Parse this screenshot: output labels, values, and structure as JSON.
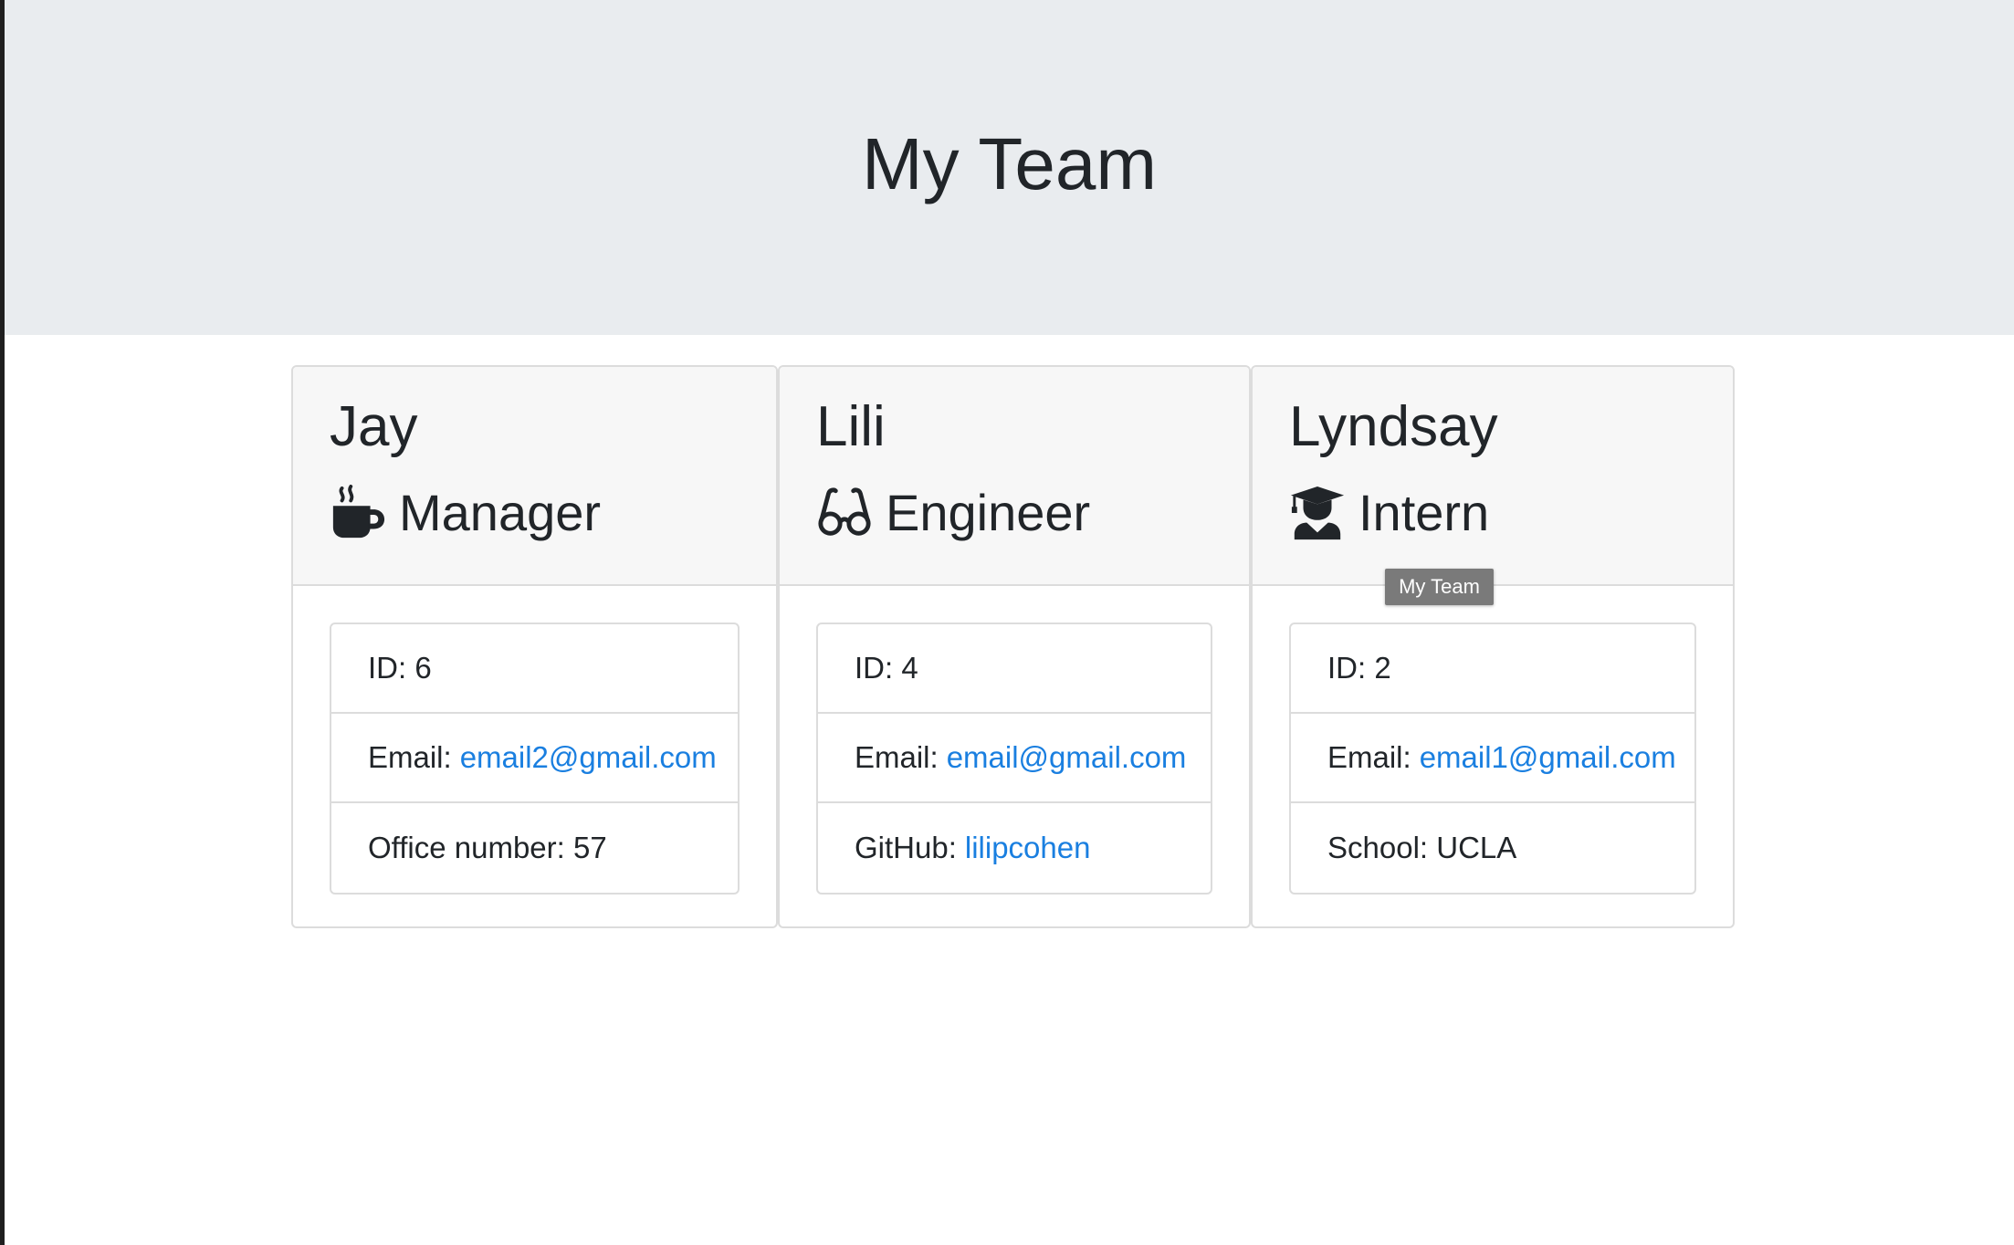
{
  "header": {
    "title": "My Team"
  },
  "team": [
    {
      "name": "Jay",
      "role": "Manager",
      "role_icon": "coffee-mug-icon",
      "id_label": "ID:",
      "id_value": "6",
      "email_label": "Email:",
      "email_value": "email2@gmail.com",
      "extra_label": "Office number:",
      "extra_value": "57"
    },
    {
      "name": "Lili",
      "role": "Engineer",
      "role_icon": "glasses-icon",
      "id_label": "ID:",
      "id_value": "4",
      "email_label": "Email:",
      "email_value": "email@gmail.com",
      "extra_label": "GitHub:",
      "extra_value": "lilipcohen"
    },
    {
      "name": "Lyndsay",
      "role": "Intern",
      "role_icon": "graduate-icon",
      "id_label": "ID:",
      "id_value": "2",
      "email_label": "Email:",
      "email_value": "email1@gmail.com",
      "extra_label": "School:",
      "extra_value": "UCLA"
    }
  ],
  "tooltip": {
    "text": "My Team"
  },
  "colors": {
    "jumbotron_bg": "#e9ecef",
    "card_header_bg": "#f7f7f7",
    "link": "#1a7fe0",
    "text": "#212529"
  }
}
